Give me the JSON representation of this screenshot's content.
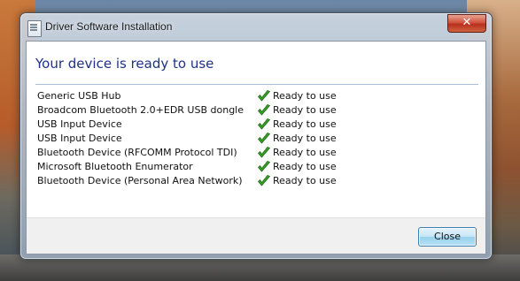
{
  "window": {
    "title": "Driver Software Installation",
    "close_glyph": "✕"
  },
  "main": {
    "heading": "Your device is ready to use",
    "devices": [
      {
        "name": "Generic USB Hub",
        "status": "Ready to use"
      },
      {
        "name": "Broadcom Bluetooth 2.0+EDR USB dongle",
        "status": "Ready to use"
      },
      {
        "name": "USB Input Device",
        "status": "Ready to use"
      },
      {
        "name": "USB Input Device",
        "status": "Ready to use"
      },
      {
        "name": "Bluetooth Device (RFCOMM Protocol TDI)",
        "status": "Ready to use"
      },
      {
        "name": "Microsoft Bluetooth Enumerator",
        "status": "Ready to use"
      },
      {
        "name": "Bluetooth Device (Personal Area Network)",
        "status": "Ready to use"
      }
    ],
    "status_icon": "green-checkmark-icon"
  },
  "footer": {
    "close_label": "Close"
  },
  "colors": {
    "heading": "#1e3287",
    "check": "#3aa12a",
    "close_button_border": "#3c7fb1"
  }
}
